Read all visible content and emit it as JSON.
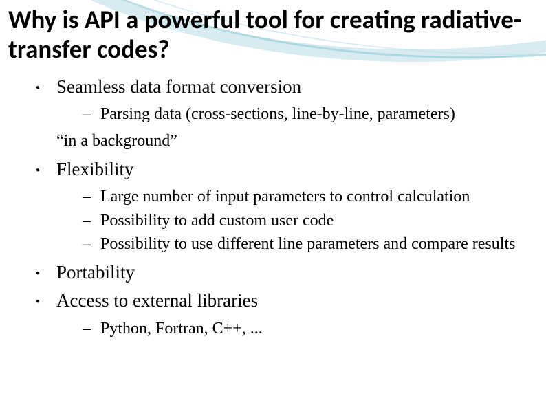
{
  "title": "Why is API a powerful tool for creating radiative-transfer codes?",
  "bullets": {
    "b1": "Seamless data format conversion",
    "b1_sub1": "Parsing data (cross-sections, line-by-line, parameters)",
    "b1_note": "“in a background”",
    "b2": "Flexibility",
    "b2_sub1": "Large number of input parameters to control calculation",
    "b2_sub2": "Possibility to add custom user code",
    "b2_sub3": "Possibility to use different line parameters and compare results",
    "b3": "Portability",
    "b4": "Access to external libraries",
    "b4_sub1": "Python, Fortran, C++, ..."
  }
}
